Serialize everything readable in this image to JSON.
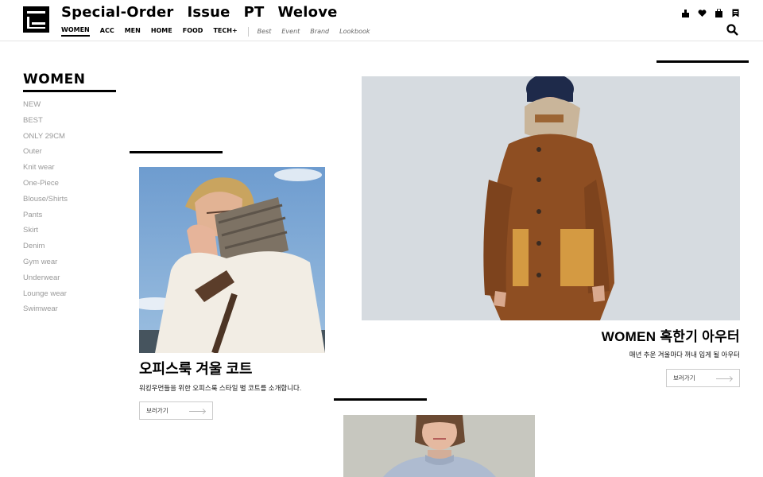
{
  "header": {
    "top_nav": [
      "Special-Order",
      "Issue",
      "PT",
      "Welove"
    ],
    "categories": [
      "WOMEN",
      "ACC",
      "MEN",
      "HOME",
      "FOOD",
      "TECH+"
    ],
    "active_category": "WOMEN",
    "sub_links": [
      "Best",
      "Event",
      "Brand",
      "Lookbook"
    ],
    "icons": [
      "my-page-icon",
      "heart-icon",
      "cart-icon",
      "bookmark-icon",
      "search-icon"
    ]
  },
  "sidebar": {
    "title": "WOMEN",
    "items": [
      "NEW",
      "BEST",
      "ONLY 29CM",
      "Outer",
      "Knit wear",
      "One-Piece",
      "Blouse/Shirts",
      "Pants",
      "Skirt",
      "Denim",
      "Gym wear",
      "Underwear",
      "Lounge wear",
      "Swimwear"
    ]
  },
  "cards": {
    "office": {
      "title": "오피스룩 겨울 코트",
      "desc": "워킹우먼들을 위한 오피스룩 스타일 별 코트를 소개합니다.",
      "button": "보러가기"
    },
    "outer": {
      "title": "WOMEN 혹한기 아우터",
      "desc": "매년 추운 겨울마다 꺼내 입게 될 아우터",
      "button": "보러가기"
    }
  },
  "colors": {
    "accent": "#000000",
    "muted_text": "#999999",
    "border": "#cccccc"
  }
}
